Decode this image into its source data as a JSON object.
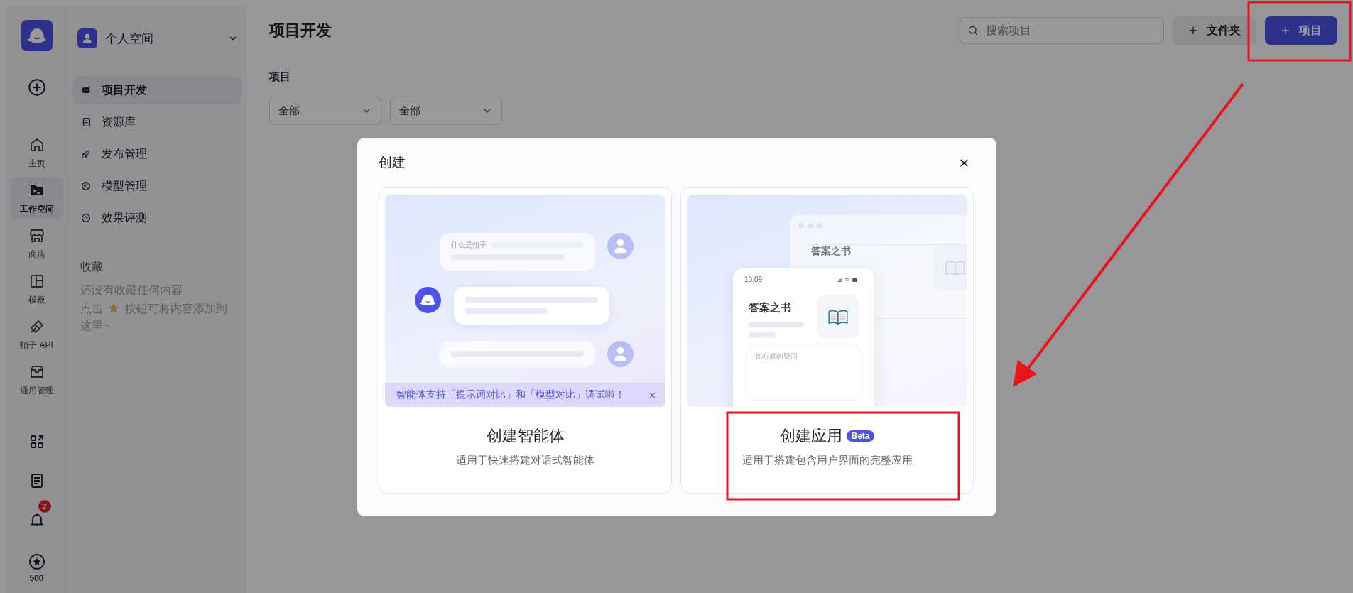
{
  "rail": {
    "items": [
      {
        "label": "主页",
        "selected": false
      },
      {
        "label": "工作空间",
        "selected": true
      },
      {
        "label": "商店",
        "selected": false
      },
      {
        "label": "模板",
        "selected": false
      },
      {
        "label": "扣子 API",
        "selected": false
      },
      {
        "label": "通用管理",
        "selected": false
      }
    ],
    "notifications_badge": "2",
    "credits": "500"
  },
  "nav": {
    "workspace": "个人空间",
    "items": [
      {
        "label": "项目开发",
        "selected": true
      },
      {
        "label": "资源库",
        "selected": false
      },
      {
        "label": "发布管理",
        "selected": false
      },
      {
        "label": "模型管理",
        "selected": false
      },
      {
        "label": "效果评测",
        "selected": false
      }
    ],
    "favorites": {
      "title": "收藏",
      "empty_line": "还没有收藏任何内容",
      "hint_before": "点击",
      "hint_after": "按钮可将内容添加到",
      "hint_end": "这里~"
    }
  },
  "main": {
    "title": "项目开发",
    "search": {
      "placeholder": "搜索项目"
    },
    "folder_button": "文件夹",
    "project_button": "项目",
    "section_label": "项目",
    "filters": [
      "全部",
      "全部"
    ]
  },
  "modal": {
    "title": "创建",
    "cards": [
      {
        "kind": "agent",
        "title": "创建智能体",
        "subtitle": "适用于快速搭建对话式智能体",
        "illustration": {
          "question": "什么是扣子"
        },
        "banner": "智能体支持「提示词对比」和「模型对比」调试啦！"
      },
      {
        "kind": "app",
        "title": "创建应用",
        "badge": "Beta",
        "subtitle": "适用于搭建包含用户界面的完整应用",
        "illustration": {
          "time": "10:09",
          "back_app_name": "答案之书",
          "app_name": "答案之书",
          "input_placeholder": "你心底的疑问"
        }
      }
    ]
  }
}
